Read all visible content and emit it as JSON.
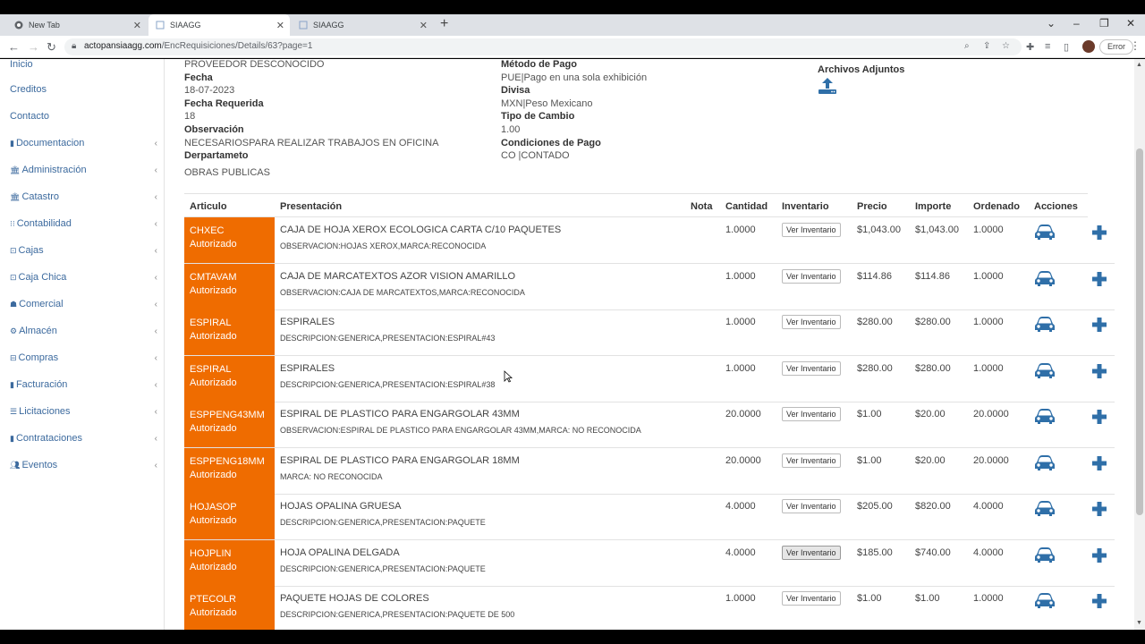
{
  "browser": {
    "tabs": [
      {
        "title": "New Tab",
        "active": false
      },
      {
        "title": "SIAAGG",
        "active": true
      },
      {
        "title": "SIAAGG",
        "active": false
      }
    ],
    "url_host": "actopansiaagg.com",
    "url_path": "/EncRequisiciones/Details/63?page=1",
    "error_label": "Error"
  },
  "sidebar": {
    "items": [
      {
        "label": "Inicio",
        "icon": "home-icon",
        "has_chevron": false
      },
      {
        "label": "Creditos",
        "icon": "",
        "has_chevron": false
      },
      {
        "label": "Contacto",
        "icon": "",
        "has_chevron": false
      },
      {
        "label": "Documentacion",
        "icon": "document-icon",
        "has_chevron": true
      },
      {
        "label": "Administración",
        "icon": "bank-icon",
        "has_chevron": true
      },
      {
        "label": "Catastro",
        "icon": "bank-icon",
        "has_chevron": true
      },
      {
        "label": "Contabilidad",
        "icon": "grid-icon",
        "has_chevron": true
      },
      {
        "label": "Cajas",
        "icon": "money-icon",
        "has_chevron": true
      },
      {
        "label": "Caja Chica",
        "icon": "money-icon",
        "has_chevron": true
      },
      {
        "label": "Comercial",
        "icon": "store-icon",
        "has_chevron": true
      },
      {
        "label": "Almacén",
        "icon": "warehouse-icon",
        "has_chevron": true
      },
      {
        "label": "Compras",
        "icon": "cart-icon",
        "has_chevron": true
      },
      {
        "label": "Facturación",
        "icon": "invoice-icon",
        "has_chevron": true
      },
      {
        "label": "Licitaciones",
        "icon": "list-icon",
        "has_chevron": true
      },
      {
        "label": "Contrataciones",
        "icon": "contract-icon",
        "has_chevron": true
      },
      {
        "label": "Eventos",
        "icon": "users-icon",
        "has_chevron": true
      }
    ]
  },
  "details": {
    "proveedor_value": "PROVEEDOR DESCONOCIDO",
    "fecha_label": "Fecha",
    "fecha_value": "18-07-2023",
    "fecha_requerida_label": "Fecha Requerida",
    "fecha_requerida_value": "18",
    "observacion_label": "Observación",
    "observacion_value": "NECESARIOSPARA REALIZAR TRABAJOS EN OFICINA",
    "departamento_label": "Derpartameto",
    "departamento_value": "OBRAS PUBLICAS",
    "metodo_pago_label": "Método de Pago",
    "metodo_pago_value": "PUE|Pago en una sola exhibición",
    "divisa_label": "Divisa",
    "divisa_value": "MXN|Peso Mexicano",
    "tipo_cambio_label": "Tipo de Cambio",
    "tipo_cambio_value": "1.00",
    "condiciones_label": "Condiciones de Pago",
    "condiciones_value": "CO |CONTADO",
    "archivos_label": "Archivos Adjuntos"
  },
  "table": {
    "headers": {
      "articulo": "Articulo",
      "presentacion": "Presentación",
      "nota": "Nota",
      "cantidad": "Cantidad",
      "inventario": "Inventario",
      "precio": "Precio",
      "importe": "Importe",
      "ordenado": "Ordenado",
      "acciones": "Acciones"
    },
    "inventory_button_label": "Ver Inventario",
    "rows": [
      {
        "code": "CHXEC",
        "status": "Autorizado",
        "presentacion": "CAJA DE HOJA XEROX ECOLOGICA CARTA C/10 PAQUETES",
        "desc": "OBSERVACION:HOJAS XEROX,MARCA:RECONOCIDA",
        "cantidad": "1.0000",
        "precio": "$1,043.00",
        "importe": "$1,043.00",
        "ordenado": "1.0000"
      },
      {
        "code": "CMTAVAM",
        "status": "Autorizado",
        "presentacion": "CAJA DE MARCATEXTOS AZOR VISION AMARILLO",
        "desc": "OBSERVACION:CAJA DE MARCATEXTOS,MARCA:RECONOCIDA",
        "cantidad": "1.0000",
        "precio": "$114.86",
        "importe": "$114.86",
        "ordenado": "1.0000"
      },
      {
        "code": "ESPIRAL",
        "status": "Autorizado",
        "presentacion": "ESPIRALES",
        "desc": "DESCRIPCION:GENERICA,PRESENTACION:ESPIRAL#43",
        "cantidad": "1.0000",
        "precio": "$280.00",
        "importe": "$280.00",
        "ordenado": "1.0000"
      },
      {
        "code": "ESPIRAL",
        "status": "Autorizado",
        "presentacion": "ESPIRALES",
        "desc": "DESCRIPCION:GENERICA,PRESENTACION:ESPIRAL#38",
        "cantidad": "1.0000",
        "precio": "$280.00",
        "importe": "$280.00",
        "ordenado": "1.0000"
      },
      {
        "code": "ESPPENG43MM",
        "status": "Autorizado",
        "presentacion": "ESPIRAL DE PLASTICO PARA ENGARGOLAR 43MM",
        "desc": "OBSERVACION:ESPIRAL DE PLASTICO PARA ENGARGOLAR 43MM,MARCA: NO RECONOCIDA",
        "cantidad": "20.0000",
        "precio": "$1.00",
        "importe": "$20.00",
        "ordenado": "20.0000"
      },
      {
        "code": "ESPPENG18MM",
        "status": "Autorizado",
        "presentacion": "ESPIRAL DE PLASTICO PARA ENGARGOLAR 18MM",
        "desc": "MARCA: NO RECONOCIDA",
        "cantidad": "20.0000",
        "precio": "$1.00",
        "importe": "$20.00",
        "ordenado": "20.0000"
      },
      {
        "code": "HOJASOP",
        "status": "Autorizado",
        "presentacion": "HOJAS OPALINA GRUESA",
        "desc": "DESCRIPCION:GENERICA,PRESENTACION:PAQUETE",
        "cantidad": "4.0000",
        "precio": "$205.00",
        "importe": "$820.00",
        "ordenado": "4.0000"
      },
      {
        "code": "HOJPLIN",
        "status": "Autorizado",
        "presentacion": "HOJA OPALINA DELGADA",
        "desc": "DESCRIPCION:GENERICA,PRESENTACION:PAQUETE",
        "cantidad": "4.0000",
        "precio": "$185.00",
        "importe": "$740.00",
        "ordenado": "4.0000"
      },
      {
        "code": "PTECOLR",
        "status": "Autorizado",
        "presentacion": "PAQUETE HOJAS DE COLORES",
        "desc": "DESCRIPCION:GENERICA,PRESENTACION:PAQUETE DE 500",
        "cantidad": "1.0000",
        "precio": "$1.00",
        "importe": "$1.00",
        "ordenado": "1.0000"
      }
    ]
  },
  "colors": {
    "code_cell": "#ef6c00",
    "icon_blue": "#2f6fa8",
    "link_blue": "#3c6a9e"
  }
}
